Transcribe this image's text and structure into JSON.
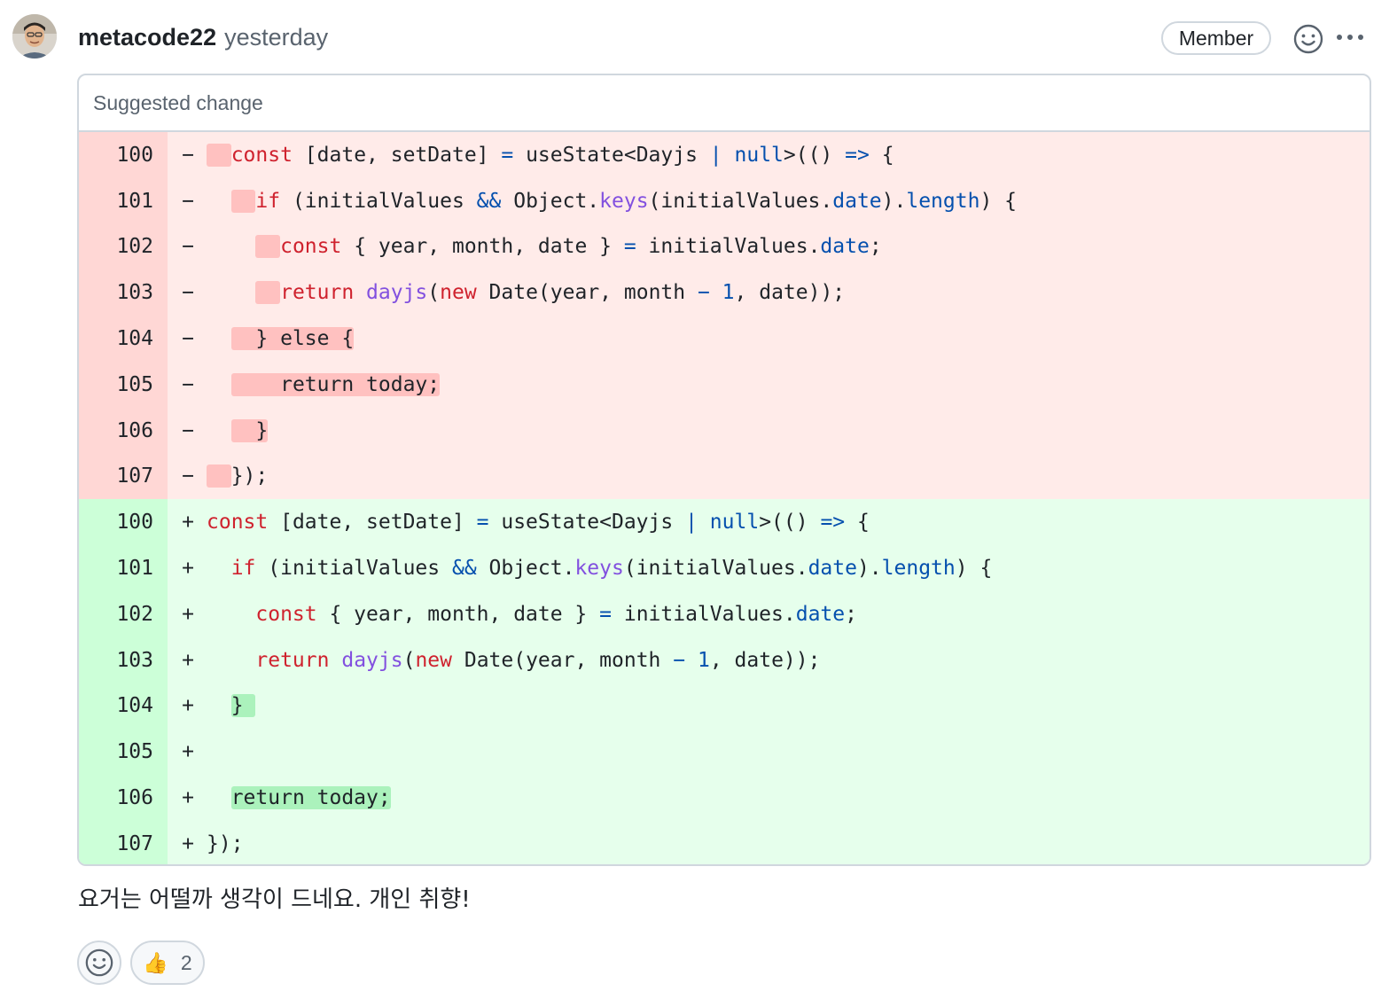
{
  "comment": {
    "author": "metacode22",
    "time": "yesterday",
    "role_badge": "Member",
    "body": "요거는 어떨까 생각이 드네요. 개인 취향!"
  },
  "suggestion": {
    "title": "Suggested change",
    "removed_lines": [
      {
        "num": "100",
        "marker": "−"
      },
      {
        "num": "101",
        "marker": "−"
      },
      {
        "num": "102",
        "marker": "−"
      },
      {
        "num": "103",
        "marker": "−"
      },
      {
        "num": "104",
        "marker": "−"
      },
      {
        "num": "105",
        "marker": "−"
      },
      {
        "num": "106",
        "marker": "−"
      },
      {
        "num": "107",
        "marker": "−"
      }
    ],
    "added_lines": [
      {
        "num": "100",
        "marker": "+"
      },
      {
        "num": "101",
        "marker": "+"
      },
      {
        "num": "102",
        "marker": "+"
      },
      {
        "num": "103",
        "marker": "+"
      },
      {
        "num": "104",
        "marker": "+"
      },
      {
        "num": "105",
        "marker": "+"
      },
      {
        "num": "106",
        "marker": "+"
      },
      {
        "num": "107",
        "marker": "+"
      }
    ],
    "tokens": {
      "const": "const",
      "if": "if",
      "return": "return",
      "new": "new",
      "else_line": "} else {",
      "return_today": "return today;",
      "close_brace": "}",
      "close_all": "});",
      "destructure": " [date, setDate] ",
      "assign": "=",
      "use_state": " useState<Dayjs ",
      "pipe": "|",
      "null": "null",
      "paren_open": ">(() ",
      "arrow": "=>",
      "brace_open": " {",
      "if_open": " (initialValues ",
      "and": "&&",
      "object": " Object.",
      "keys": "keys",
      "initial_values_open": "(initialValues.",
      "date_prop": "date",
      "dot_close": ").",
      "length": "length",
      "if_close": ") {",
      "destructure_fields": " { year, month, date } ",
      "initial_values": " initialValues.",
      "semicolon": ";",
      "space": " ",
      "dayjs": "dayjs",
      "paren": "(",
      "date_ctor": " Date(year, month ",
      "minus": "−",
      "one": "1",
      "date_close": ", date));"
    }
  },
  "reactions": [
    {
      "emoji": "👍",
      "count": "2"
    }
  ],
  "icons": {
    "avatar": "user-avatar",
    "react": "smiley-icon",
    "more": "kebab-horizontal-icon",
    "thumbs": "thumbs-up-emoji"
  }
}
